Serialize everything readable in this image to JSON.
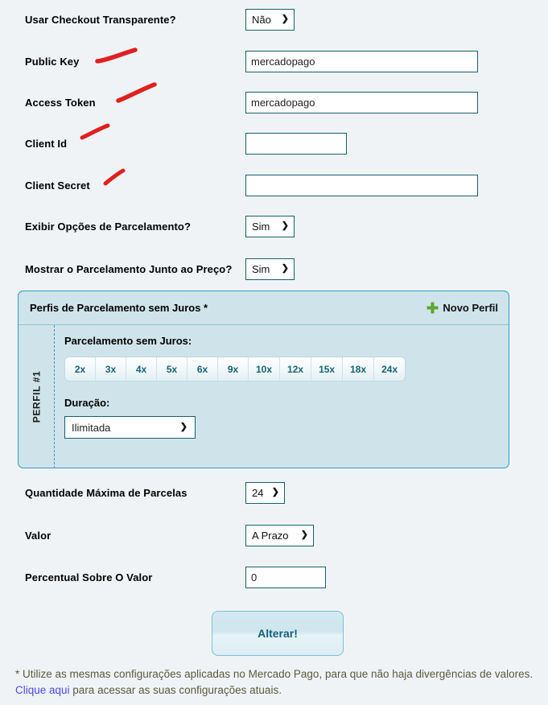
{
  "form": {
    "rows": [
      {
        "label": "Usar Checkout Transparente?",
        "control": "select",
        "value": "Não"
      },
      {
        "label": "Public Key",
        "control": "text",
        "value": "mercadopago"
      },
      {
        "label": "Access Token",
        "control": "text",
        "value": "mercadopago"
      },
      {
        "label": "Client Id",
        "control": "text",
        "value": ""
      },
      {
        "label": "Client Secret",
        "control": "text",
        "value": ""
      },
      {
        "label": "Exibir Opções de Parcelamento?",
        "control": "select",
        "value": "Sim"
      },
      {
        "label": "Mostrar o Parcelamento Junto ao Preço?",
        "control": "select",
        "value": "Sim"
      },
      {
        "label": "Quantidade Máxima de Parcelas",
        "control": "select",
        "value": "24"
      },
      {
        "label": "Valor",
        "control": "select",
        "value": "A Prazo"
      },
      {
        "label": "Percentual Sobre O Valor",
        "control": "text",
        "value": "0"
      }
    ]
  },
  "panel": {
    "title": "Perfis de Parcelamento sem Juros *",
    "new_profile_label": "Novo Perfil",
    "profile_tab_label": "PERFIL #1",
    "installments_label": "Parcelamento sem Juros:",
    "installment_options": [
      "2x",
      "3x",
      "4x",
      "5x",
      "6x",
      "9x",
      "10x",
      "12x",
      "15x",
      "18x",
      "24x"
    ],
    "duration_label": "Duração:",
    "duration_value": "Ilimitada"
  },
  "submit": {
    "label": "Alterar!"
  },
  "footnote": {
    "part1": "* Utilize as mesmas configurações aplicadas no Mercado Pago, para que não haja divergências de valores. ",
    "link": "Clique aqui",
    "part2": " para acessar as suas configurações atuais."
  },
  "colors": {
    "page_background": "#f0f3f6",
    "panel_background": "#cfe3ea",
    "panel_border": "#2a9ec4",
    "field_border": "#13616e",
    "accent_teal": "#14607a",
    "plus_green": "#5fb02a",
    "link_blue": "#4a4ae8",
    "marker_red": "#e02020"
  },
  "annotations": {
    "marker_count": 4,
    "marker_color": "#e02020",
    "targets": [
      "Public Key",
      "Access Token",
      "Client Id",
      "Client Secret"
    ]
  }
}
